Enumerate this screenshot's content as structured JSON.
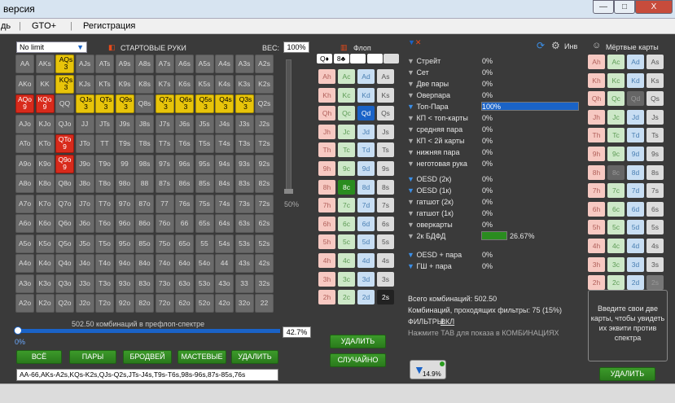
{
  "window": {
    "title_fragment": "версия",
    "minimize": "—",
    "maximize": "□",
    "close": "X"
  },
  "menu": {
    "items": [
      "дь",
      "GTO+",
      "Регистрация"
    ]
  },
  "range": {
    "mode": "No limit",
    "start_hands_label": "СТАРТОВЫЕ РУКИ",
    "weight_label": "ВЕС:",
    "weight_value": "100%",
    "slider_pct": "50%",
    "combos_text": "502.50 комбинаций в префлоп-спектре",
    "range_pct": "42.7%",
    "zero_pct": "0%",
    "rows": [
      [
        "AA",
        "AKs",
        "AQs",
        "AJs",
        "ATs",
        "A9s",
        "A8s",
        "A7s",
        "A6s",
        "A5s",
        "A4s",
        "A3s",
        "A2s"
      ],
      [
        "AKo",
        "KK",
        "KQs",
        "KJs",
        "KTs",
        "K9s",
        "K8s",
        "K7s",
        "K6s",
        "K5s",
        "K4s",
        "K3s",
        "K2s"
      ],
      [
        "AQo",
        "KQo",
        "QQ",
        "QJs",
        "QTs",
        "Q9s",
        "Q8s",
        "Q7s",
        "Q6s",
        "Q5s",
        "Q4s",
        "Q3s",
        "Q2s"
      ],
      [
        "AJo",
        "KJo",
        "QJo",
        "JJ",
        "JTs",
        "J9s",
        "J8s",
        "J7s",
        "J6s",
        "J5s",
        "J4s",
        "J3s",
        "J2s"
      ],
      [
        "ATo",
        "KTo",
        "QTo",
        "JTo",
        "TT",
        "T9s",
        "T8s",
        "T7s",
        "T6s",
        "T5s",
        "T4s",
        "T3s",
        "T2s"
      ],
      [
        "A9o",
        "K9o",
        "Q9o",
        "J9o",
        "T9o",
        "99",
        "98s",
        "97s",
        "96s",
        "95s",
        "94s",
        "93s",
        "92s"
      ],
      [
        "A8o",
        "K8o",
        "Q8o",
        "J8o",
        "T8o",
        "98o",
        "88",
        "87s",
        "86s",
        "85s",
        "84s",
        "83s",
        "82s"
      ],
      [
        "A7o",
        "K7o",
        "Q7o",
        "J7o",
        "T7o",
        "97o",
        "87o",
        "77",
        "76s",
        "75s",
        "74s",
        "73s",
        "72s"
      ],
      [
        "A6o",
        "K6o",
        "Q6o",
        "J6o",
        "T6o",
        "96o",
        "86o",
        "76o",
        "66",
        "65s",
        "64s",
        "63s",
        "62s"
      ],
      [
        "A5o",
        "K5o",
        "Q5o",
        "J5o",
        "T5o",
        "95o",
        "85o",
        "75o",
        "65o",
        "55",
        "54s",
        "53s",
        "52s"
      ],
      [
        "A4o",
        "K4o",
        "Q4o",
        "J4o",
        "T4o",
        "94o",
        "84o",
        "74o",
        "64o",
        "54o",
        "44",
        "43s",
        "42s"
      ],
      [
        "A3o",
        "K3o",
        "Q3o",
        "J3o",
        "T3o",
        "93o",
        "83o",
        "73o",
        "63o",
        "53o",
        "43o",
        "33",
        "32s"
      ],
      [
        "A2o",
        "K2o",
        "Q2o",
        "J2o",
        "T2o",
        "92o",
        "82o",
        "72o",
        "62o",
        "52o",
        "42o",
        "32o",
        "22"
      ]
    ],
    "highlighted": {
      "yellow": [
        [
          "AQs",
          "3"
        ],
        [
          "KQs",
          "3"
        ],
        [
          "QJs",
          "3"
        ],
        [
          "QTs",
          "3"
        ],
        [
          "Q9s",
          "3"
        ],
        [
          "Q7s",
          "3"
        ],
        [
          "Q6s",
          "3"
        ],
        [
          "Q5s",
          "3"
        ],
        [
          "Q4s",
          "3"
        ],
        [
          "Q3s",
          "3"
        ]
      ],
      "red": [
        [
          "AQo",
          "9"
        ],
        [
          "KQo",
          "9"
        ],
        [
          "QTo",
          "9"
        ],
        [
          "Q9o",
          "9"
        ]
      ]
    },
    "buttons": [
      "ВСЁ",
      "ПАРЫ",
      "БРОДВЕЙ",
      "МАСТЕВЫЕ",
      "УДАЛИТЬ"
    ],
    "hands_text": "AA-66,AKs-A2s,KQs-K2s,QJs-Q2s,JTs-J4s,T9s-T6s,98s-96s,87s-85s,76s"
  },
  "flop": {
    "label": "Флоп",
    "slots": [
      "Q♦",
      "8♣",
      "",
      ""
    ],
    "ranks": [
      "A",
      "K",
      "Q",
      "J",
      "T",
      "9",
      "8",
      "7",
      "6",
      "5",
      "4",
      "3",
      "2"
    ],
    "suits": [
      "h",
      "c",
      "d",
      "s"
    ],
    "selected": [
      "Qd",
      "8c"
    ],
    "delete_label": "УДАЛИТЬ",
    "random_label": "СЛУЧАЙНО"
  },
  "filters": {
    "inv_label": "Инв",
    "items": [
      {
        "name": "Стрейт",
        "val": "0%"
      },
      {
        "name": "Сет",
        "val": "0%"
      },
      {
        "name": "Две пары",
        "val": "0%"
      },
      {
        "name": "Оверпара",
        "val": "0%"
      },
      {
        "name": "Топ-Пара",
        "val": "100%",
        "bar": 1.0,
        "color": "#1a63c7"
      },
      {
        "name": "КП < топ-карты",
        "val": "0%"
      },
      {
        "name": "средняя пара",
        "val": "0%"
      },
      {
        "name": "КП < 2й карты",
        "val": "0%"
      },
      {
        "name": "нижняя пара",
        "val": "0%"
      },
      {
        "name": "неготовая рука",
        "val": "0%"
      },
      {
        "name": "OESD (2к)",
        "val": "0%"
      },
      {
        "name": "OESD (1к)",
        "val": "0%"
      },
      {
        "name": "гатшот (2к)",
        "val": "0%"
      },
      {
        "name": "гатшот (1к)",
        "val": "0%"
      },
      {
        "name": "оверкарты",
        "val": "0%"
      },
      {
        "name": "2к БДФД",
        "val": "26.67%",
        "bar": 0.27,
        "color": "#2a8c1f"
      },
      {
        "name": "OESD + пара",
        "val": "0%"
      },
      {
        "name": "ГШ + пара",
        "val": "0%"
      }
    ],
    "total_combos": "Всего комбинаций: 502.50",
    "passed_combos": "Комбинаций, проходящих фильтры: 75 (15%)",
    "filters_label": "ФИЛЬТРЫ:",
    "filters_state": "ВКЛ",
    "tab_hint": "Нажмите TAB для показа в КОМБИНАЦИЯХ",
    "stat_pct": "14.9%"
  },
  "dead": {
    "label": "Мёртвые карты",
    "note": "Введите свои две карты, чтобы увидеть их эквити против спектра",
    "delete_label": "УДАЛИТЬ"
  }
}
